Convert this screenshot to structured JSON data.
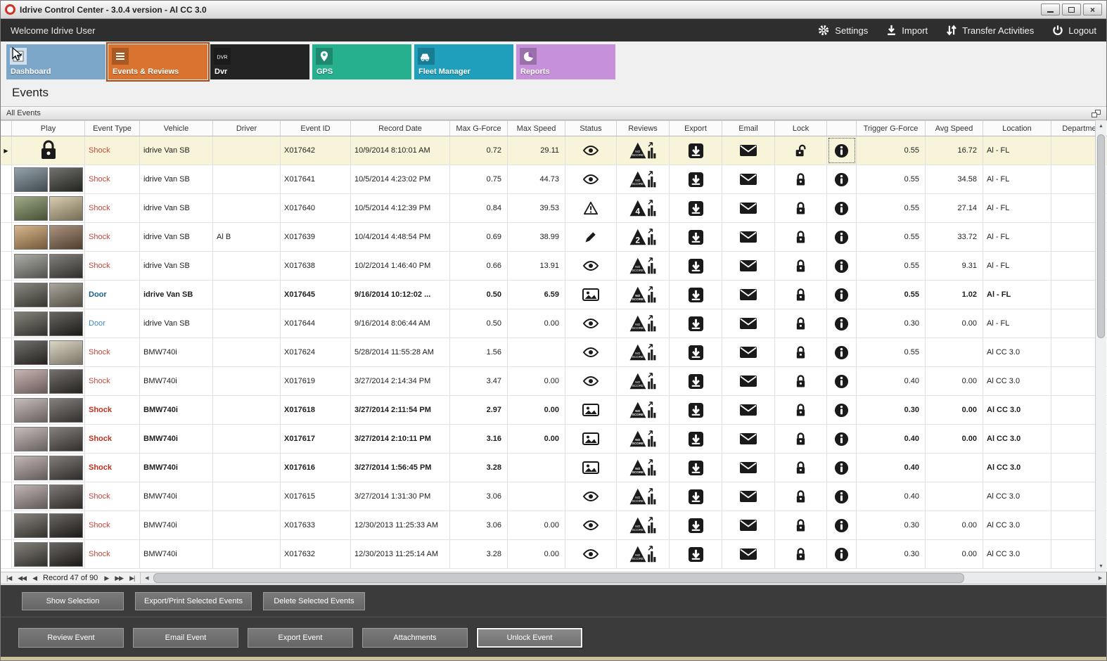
{
  "window": {
    "title": "Idrive Control Center - 3.0.4 version - Al CC 3.0",
    "controls": [
      {
        "id": "minimize",
        "icon": "minimize-icon"
      },
      {
        "id": "maximize",
        "icon": "maximize-icon"
      },
      {
        "id": "close",
        "icon": "close-icon"
      }
    ]
  },
  "topbar": {
    "welcome": "Welcome Idrive User",
    "actions": [
      {
        "id": "settings",
        "label": "Settings",
        "icon": "gear-icon"
      },
      {
        "id": "import",
        "label": "Import",
        "icon": "import-icon"
      },
      {
        "id": "transfer-activities",
        "label": "Transfer Activities",
        "icon": "transfer-icon"
      },
      {
        "id": "logout",
        "label": "Logout",
        "icon": "power-icon"
      }
    ]
  },
  "tabs": [
    {
      "id": "dashboard",
      "label": "Dashboard",
      "color": "#7da7c9",
      "icon": "dashboard-icon",
      "icon_light": true,
      "active": false
    },
    {
      "id": "events-reviews",
      "label": "Events & Reviews",
      "color": "#d9732f",
      "icon": "events-list-icon",
      "icon_light": false,
      "active": true
    },
    {
      "id": "dvr",
      "label": "Dvr",
      "color": "#232323",
      "icon": "dvr-icon",
      "icon_light": false,
      "active": false
    },
    {
      "id": "gps",
      "label": "GPS",
      "color": "#27b08d",
      "icon": "map-pin-icon",
      "icon_light": false,
      "active": false
    },
    {
      "id": "fleet-manager",
      "label": "Fleet Manager",
      "color": "#1f9fbb",
      "icon": "fleet-icon",
      "icon_light": false,
      "active": false
    },
    {
      "id": "reports",
      "label": "Reports",
      "color": "#c690da",
      "icon": "pie-chart-icon",
      "icon_light": false,
      "active": false
    }
  ],
  "page": {
    "heading": "Events",
    "group_title": "All Events"
  },
  "table": {
    "columns": [
      "Play",
      "Event Type",
      "Vehicle",
      "Driver",
      "Event ID",
      "Record Date",
      "Max G-Force",
      "Max Speed",
      "Status",
      "Reviews",
      "Export",
      "Email",
      "Lock",
      "",
      "Trigger G-Force",
      "Avg Speed",
      "Location",
      "Departme"
    ],
    "rows": [
      {
        "selected": true,
        "bold": false,
        "play": "locked",
        "thumb": [],
        "event_type": "Shock",
        "type_class": "type-shock",
        "vehicle": "idrive Van SB",
        "driver": "",
        "event_id": "X017642",
        "record_date": "10/9/2014 8:10:01 AM",
        "max_g": "0.72",
        "max_speed": "29.11",
        "status_icon": "eye-icon",
        "review": "NO SCORE",
        "lock_icon": "unlock-icon",
        "trigger_g": "0.55",
        "avg_speed": "16.72",
        "location": "Al - FL"
      },
      {
        "selected": false,
        "bold": false,
        "play": "thumbs",
        "thumb": [
          "#6e7f8a",
          "#3b3b36"
        ],
        "event_type": "Shock",
        "type_class": "type-shock",
        "vehicle": "idrive Van SB",
        "driver": "",
        "event_id": "X017641",
        "record_date": "10/5/2014 4:23:02 PM",
        "max_g": "0.75",
        "max_speed": "44.73",
        "status_icon": "eye-icon",
        "review": "NO SCORE",
        "lock_icon": "lock-icon",
        "trigger_g": "0.55",
        "avg_speed": "34.58",
        "location": "Al - FL"
      },
      {
        "selected": false,
        "bold": false,
        "play": "thumbs",
        "thumb": [
          "#7a8a5a",
          "#caba92"
        ],
        "event_type": "Shock",
        "type_class": "type-shock",
        "vehicle": "idrive Van SB",
        "driver": "",
        "event_id": "X017640",
        "record_date": "10/5/2014 4:12:39 PM",
        "max_g": "0.84",
        "max_speed": "39.53",
        "status_icon": "warning-icon",
        "review": "4",
        "lock_icon": "lock-icon",
        "trigger_g": "0.55",
        "avg_speed": "27.14",
        "location": "Al - FL"
      },
      {
        "selected": false,
        "bold": false,
        "play": "thumbs",
        "thumb": [
          "#c79a62",
          "#8a6a4e"
        ],
        "event_type": "Shock",
        "type_class": "type-shock",
        "vehicle": "idrive Van SB",
        "driver": "Al B",
        "event_id": "X017639",
        "record_date": "10/4/2014 4:48:54 PM",
        "max_g": "0.69",
        "max_speed": "38.99",
        "status_icon": "pencil-icon",
        "review": "2",
        "lock_icon": "lock-icon",
        "trigger_g": "0.55",
        "avg_speed": "33.72",
        "location": "Al - FL"
      },
      {
        "selected": false,
        "bold": false,
        "play": "thumbs",
        "thumb": [
          "#8e8e86",
          "#52504a"
        ],
        "event_type": "Shock",
        "type_class": "type-shock",
        "vehicle": "idrive Van SB",
        "driver": "",
        "event_id": "X017638",
        "record_date": "10/2/2014 1:46:40 PM",
        "max_g": "0.66",
        "max_speed": "13.91",
        "status_icon": "eye-icon",
        "review": "NO SCORE",
        "lock_icon": "lock-icon",
        "trigger_g": "0.55",
        "avg_speed": "9.31",
        "location": "Al - FL"
      },
      {
        "selected": false,
        "bold": true,
        "play": "thumbs",
        "thumb": [
          "#5c5c50",
          "#8a8474"
        ],
        "event_type": "Door",
        "type_class": "type-door-dark",
        "vehicle": "idrive Van SB",
        "driver": "",
        "event_id": "X017645",
        "record_date": "9/16/2014 10:12:02 ...",
        "max_g": "0.50",
        "max_speed": "6.59",
        "status_icon": "image-icon",
        "review": "NO SCORE",
        "lock_icon": "lock-icon",
        "trigger_g": "0.55",
        "avg_speed": "1.02",
        "location": "Al - FL"
      },
      {
        "selected": false,
        "bold": false,
        "play": "thumbs",
        "thumb": [
          "#56544a",
          "#2e2c26"
        ],
        "event_type": "Door",
        "type_class": "type-door",
        "vehicle": "idrive Van SB",
        "driver": "",
        "event_id": "X017644",
        "record_date": "9/16/2014 8:06:44 AM",
        "max_g": "0.50",
        "max_speed": "0.00",
        "status_icon": "eye-icon",
        "review": "NO SCORE",
        "lock_icon": "lock-icon",
        "trigger_g": "0.30",
        "avg_speed": "0.00",
        "location": "Al - FL"
      },
      {
        "selected": false,
        "bold": false,
        "play": "thumbs",
        "thumb": [
          "#3c3a34",
          "#cfc6ae"
        ],
        "event_type": "Shock",
        "type_class": "type-shock",
        "vehicle": "BMW740i",
        "driver": "",
        "event_id": "X017624",
        "record_date": "5/28/2014 11:55:28 AM",
        "max_g": "1.56",
        "max_speed": "",
        "status_icon": "eye-icon",
        "review": "NO SCORE",
        "lock_icon": "lock-icon",
        "trigger_g": "0.55",
        "avg_speed": "",
        "location": "Al CC 3.0"
      },
      {
        "selected": false,
        "bold": false,
        "play": "thumbs",
        "thumb": [
          "#b49a98",
          "#3e3a36"
        ],
        "event_type": "Shock",
        "type_class": "type-shock",
        "vehicle": "BMW740i",
        "driver": "",
        "event_id": "X017619",
        "record_date": "3/27/2014 2:14:34 PM",
        "max_g": "3.47",
        "max_speed": "0.00",
        "status_icon": "eye-icon",
        "review": "NO SCORE",
        "lock_icon": "lock-icon",
        "trigger_g": "0.40",
        "avg_speed": "0.00",
        "location": "Al CC 3.0"
      },
      {
        "selected": false,
        "bold": true,
        "play": "thumbs",
        "thumb": [
          "#b2a4a2",
          "#56504c"
        ],
        "event_type": "Shock",
        "type_class": "type-shock",
        "vehicle": "BMW740i",
        "driver": "",
        "event_id": "X017618",
        "record_date": "3/27/2014 2:11:54 PM",
        "max_g": "2.97",
        "max_speed": "0.00",
        "status_icon": "image-icon",
        "review": "NO SCORE",
        "lock_icon": "lock-icon",
        "trigger_g": "0.30",
        "avg_speed": "0.00",
        "location": "Al CC 3.0"
      },
      {
        "selected": false,
        "bold": true,
        "play": "thumbs",
        "thumb": [
          "#b2a4a2",
          "#56504c"
        ],
        "event_type": "Shock",
        "type_class": "type-shock",
        "vehicle": "BMW740i",
        "driver": "",
        "event_id": "X017617",
        "record_date": "3/27/2014 2:10:11 PM",
        "max_g": "3.16",
        "max_speed": "0.00",
        "status_icon": "image-icon",
        "review": "NO SCORE",
        "lock_icon": "lock-icon",
        "trigger_g": "0.40",
        "avg_speed": "0.00",
        "location": "Al CC 3.0"
      },
      {
        "selected": false,
        "bold": true,
        "play": "thumbs",
        "thumb": [
          "#aa9c9a",
          "#504a46"
        ],
        "event_type": "Shock",
        "type_class": "type-shock",
        "vehicle": "BMW740i",
        "driver": "",
        "event_id": "X017616",
        "record_date": "3/27/2014 1:56:45 PM",
        "max_g": "3.28",
        "max_speed": "",
        "status_icon": "image-icon",
        "review": "NO SCORE",
        "lock_icon": "lock-icon",
        "trigger_g": "0.40",
        "avg_speed": "",
        "location": "Al CC 3.0"
      },
      {
        "selected": false,
        "bold": false,
        "play": "thumbs",
        "thumb": [
          "#a89a98",
          "#4c4642"
        ],
        "event_type": "Shock",
        "type_class": "type-shock",
        "vehicle": "BMW740i",
        "driver": "",
        "event_id": "X017615",
        "record_date": "3/27/2014 1:31:30 PM",
        "max_g": "3.06",
        "max_speed": "",
        "status_icon": "eye-icon",
        "review": "NO SCORE",
        "lock_icon": "lock-icon",
        "trigger_g": "0.40",
        "avg_speed": "",
        "location": "Al CC 3.0"
      },
      {
        "selected": false,
        "bold": false,
        "play": "thumbs",
        "thumb": [
          "#5a564e",
          "#302c28"
        ],
        "event_type": "Shock",
        "type_class": "type-shock",
        "vehicle": "BMW740i",
        "driver": "",
        "event_id": "X017633",
        "record_date": "12/30/2013 11:25:33 AM",
        "max_g": "3.06",
        "max_speed": "0.00",
        "status_icon": "eye-icon",
        "review": "NO SCORE",
        "lock_icon": "lock-icon",
        "trigger_g": "0.30",
        "avg_speed": "0.00",
        "location": "Al CC 3.0"
      },
      {
        "selected": false,
        "bold": false,
        "play": "thumbs",
        "thumb": [
          "#55514a",
          "#2e2a26"
        ],
        "event_type": "Shock",
        "type_class": "type-shock",
        "vehicle": "BMW740i",
        "driver": "",
        "event_id": "X017632",
        "record_date": "12/30/2013 11:25:14 AM",
        "max_g": "3.28",
        "max_speed": "0.00",
        "status_icon": "eye-icon",
        "review": "NO SCORE",
        "lock_icon": "lock-icon",
        "trigger_g": "0.30",
        "avg_speed": "0.00",
        "location": "Al CC 3.0"
      }
    ]
  },
  "pager": {
    "label": "Record 47 of 90",
    "buttons_left": [
      "first",
      "prev-page",
      "prev"
    ],
    "buttons_right": [
      "next",
      "next-page",
      "last"
    ]
  },
  "selection_bar": {
    "buttons": [
      "Show Selection",
      "Export/Print Selected Events",
      "Delete Selected  Events"
    ]
  },
  "action_bar": {
    "buttons": [
      "Review Event",
      "Email Event",
      "Export Event",
      "Attachments",
      "Unlock Event"
    ],
    "focused": "Unlock Event"
  }
}
